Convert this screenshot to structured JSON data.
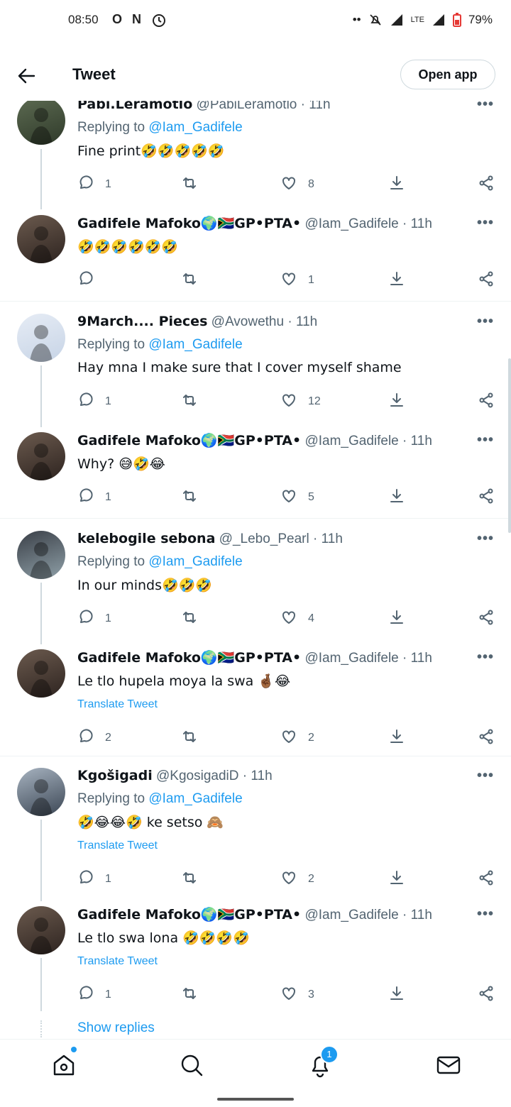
{
  "status_bar": {
    "time": "08:50",
    "left_icons": [
      "O",
      "N",
      "alarm-icon"
    ],
    "network": "LTE",
    "battery": "79%"
  },
  "header": {
    "title": "Tweet",
    "open_app": "Open app"
  },
  "translate_label": "Translate Tweet",
  "replying_to_label": "Replying to",
  "show_replies": "Show replies",
  "tweets": [
    {
      "name": "Pabi.Leramotlo",
      "handle": "@PabiLeramotlo",
      "time": "· 11h",
      "replying": "@Iam_Gadifele",
      "text": "Fine print🤣🤣🤣🤣🤣",
      "reply_count": "1",
      "like_count": "8",
      "translate": false
    },
    {
      "name": "Gadifele Mafoko🌍🇿🇦GP•PTA•",
      "handle": "@Iam_Gadifele",
      "time": "· 11h",
      "replying": "",
      "text": "🤣🤣🤣🤣🤣🤣",
      "reply_count": "",
      "like_count": "1",
      "translate": false
    },
    {
      "name": "9March.... Pieces",
      "handle": "@Avowethu",
      "time": "· 11h",
      "replying": "@Iam_Gadifele",
      "text": "Hay mna I make sure that I cover myself shame",
      "reply_count": "1",
      "like_count": "12",
      "translate": false
    },
    {
      "name": "Gadifele Mafoko🌍🇿🇦GP•PTA•",
      "handle": "@Iam_Gadifele",
      "time": "· 11h",
      "replying": "",
      "text": "Why? 😅🤣😂",
      "reply_count": "1",
      "like_count": "5",
      "translate": false
    },
    {
      "name": "kelebogile sebona",
      "handle": "@_Lebo_Pearl",
      "time": "· 11h",
      "replying": "@Iam_Gadifele",
      "text": "In our minds🤣🤣🤣",
      "reply_count": "1",
      "like_count": "4",
      "translate": false
    },
    {
      "name": "Gadifele Mafoko🌍🇿🇦GP•PTA•",
      "handle": "@Iam_Gadifele",
      "time": "· 11h",
      "replying": "",
      "text": "Le tlo hupela moya la swa 🤞🏾😂",
      "reply_count": "2",
      "like_count": "2",
      "translate": true
    },
    {
      "name": "Kgošigadi",
      "handle": "@KgosigadiD",
      "time": "· 11h",
      "replying": "@Iam_Gadifele",
      "text": "🤣😂😂🤣 ke setso 🙈",
      "reply_count": "1",
      "like_count": "2",
      "translate": true
    },
    {
      "name": "Gadifele Mafoko🌍🇿🇦GP•PTA•",
      "handle": "@Iam_Gadifele",
      "time": "· 11h",
      "replying": "",
      "text": "Le tlo swa lona 🤣🤣🤣🤣",
      "reply_count": "1",
      "like_count": "3",
      "translate": true
    }
  ],
  "bottom_nav": {
    "notifications_badge": "1",
    "items": [
      "home-icon",
      "search-icon",
      "notifications-icon",
      "messages-icon"
    ]
  },
  "colors": {
    "accent": "#1d9bf0",
    "text": "#0f1419",
    "secondary": "#536471"
  }
}
